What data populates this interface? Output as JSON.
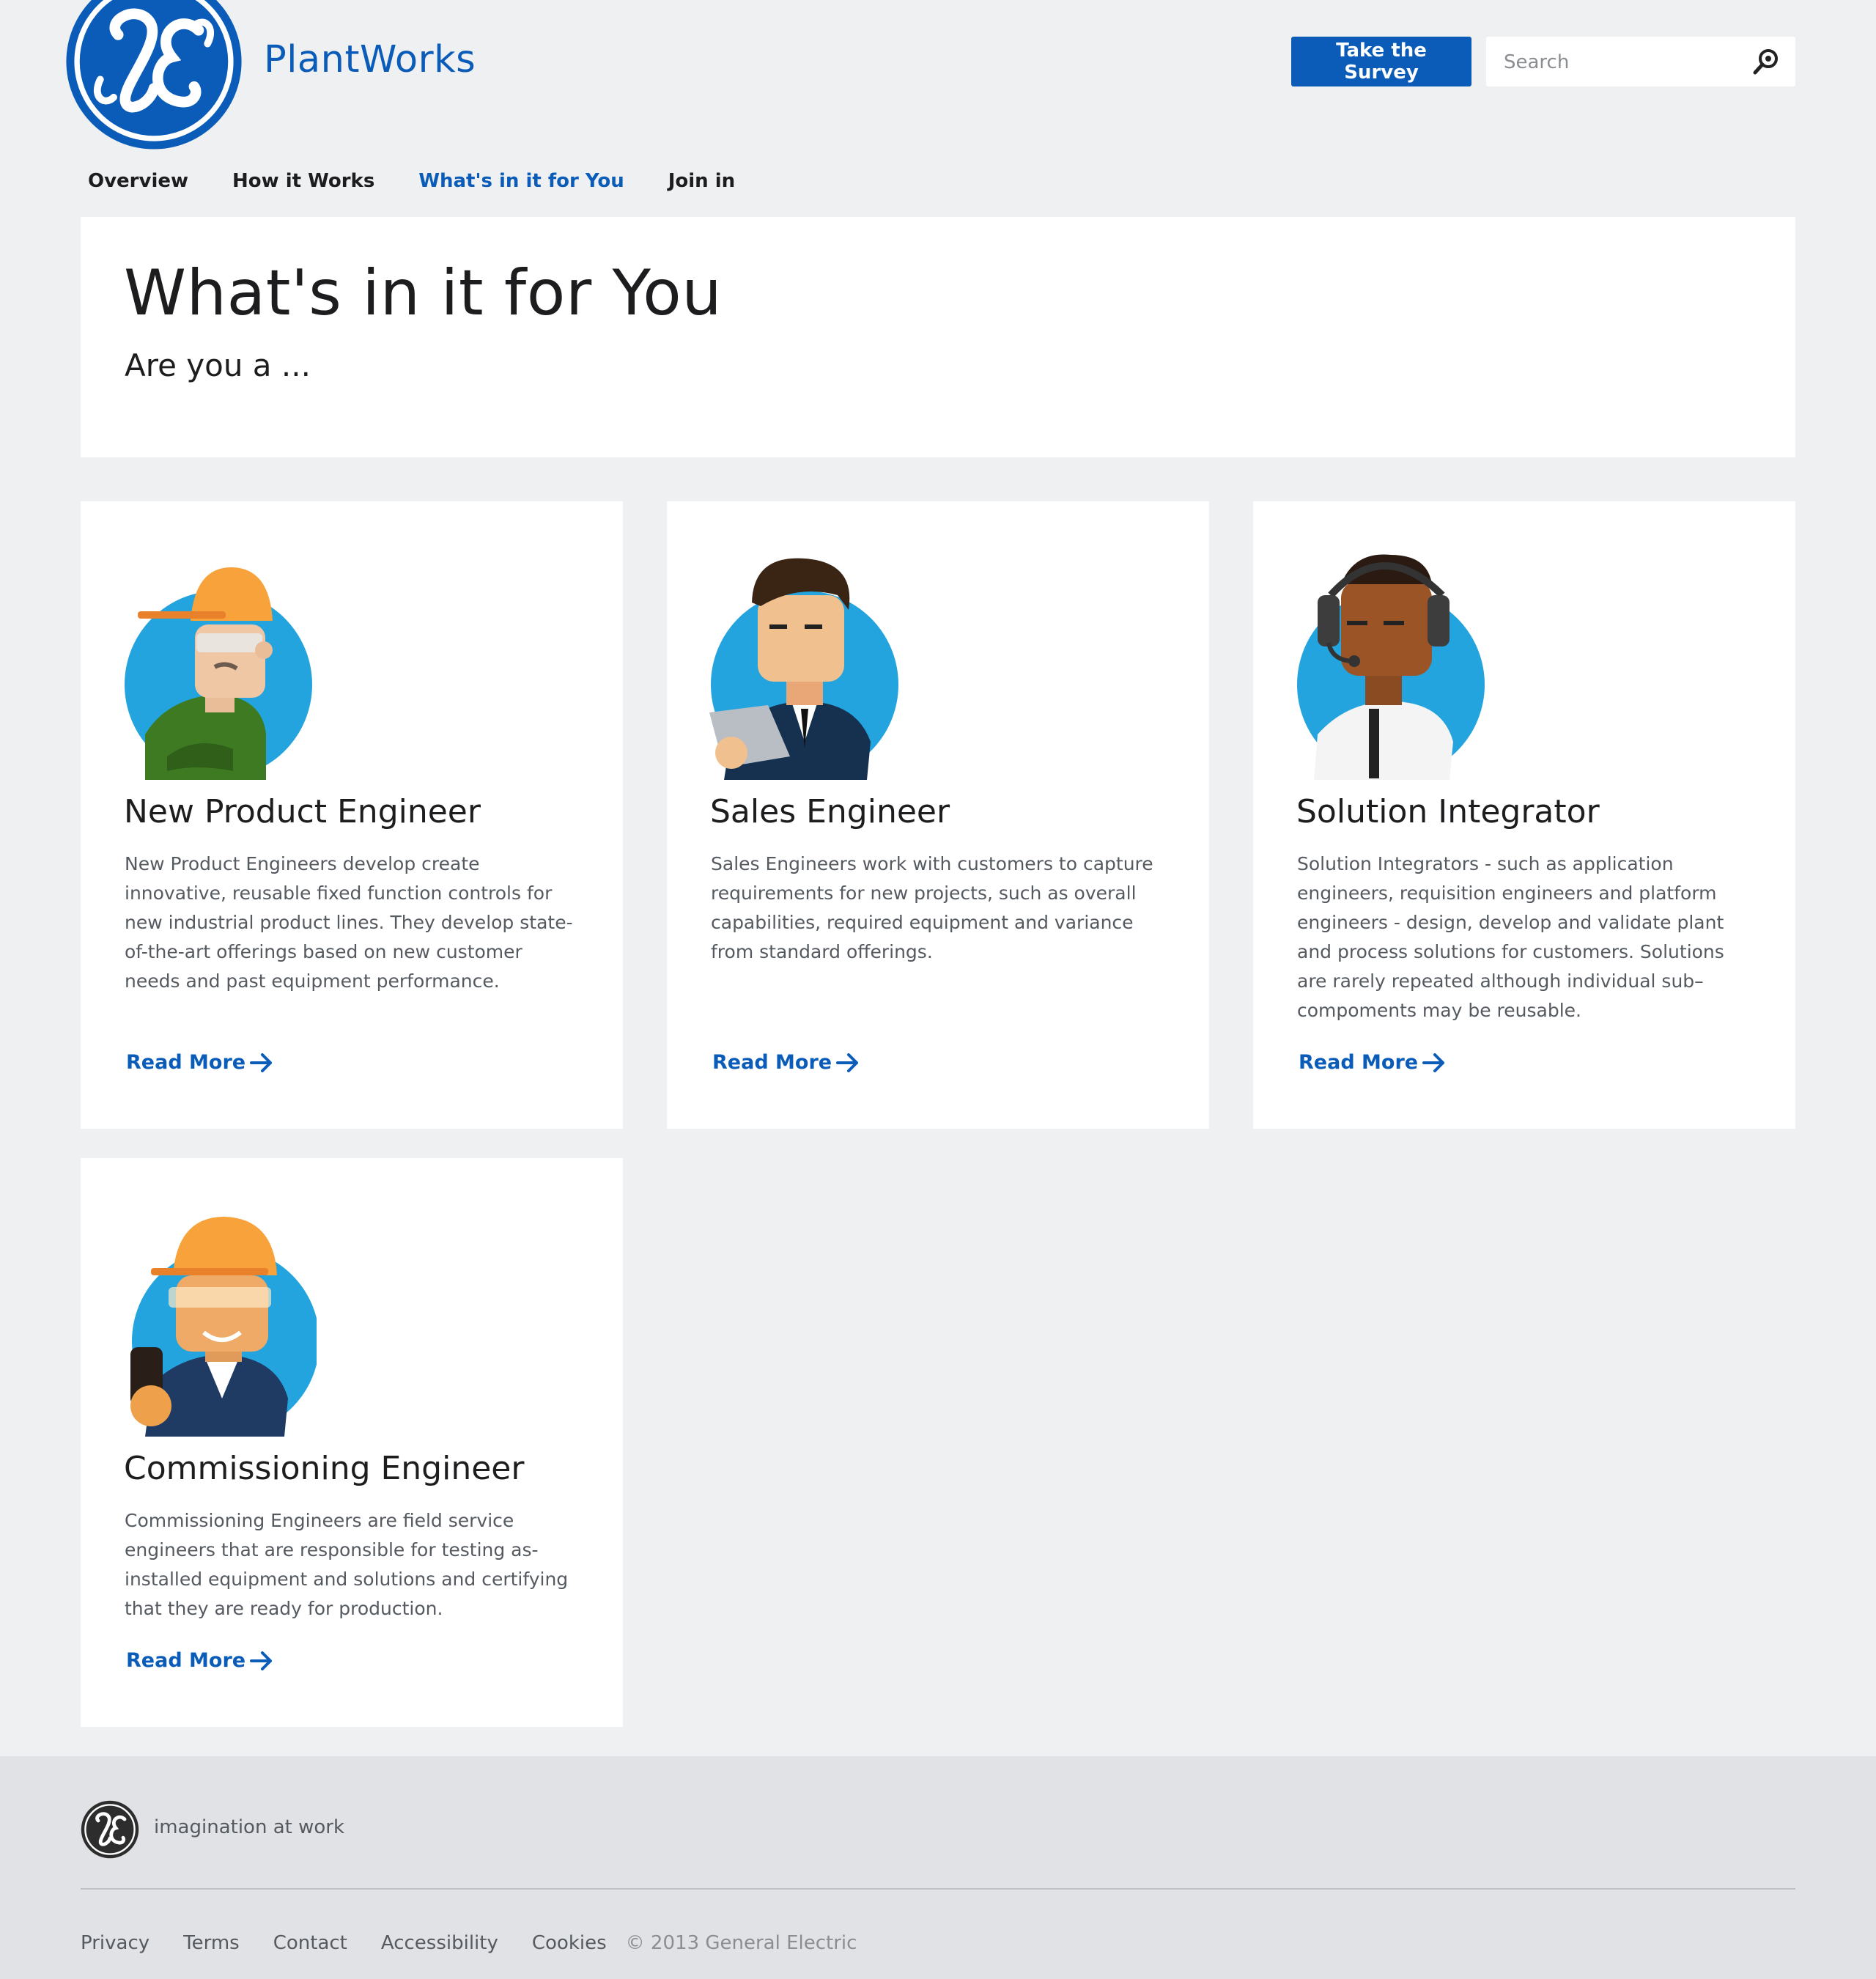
{
  "header": {
    "brand": "PlantWorks",
    "survey_label": "Take the Survey",
    "search_placeholder": "Search"
  },
  "nav": {
    "items": [
      {
        "label": "Overview"
      },
      {
        "label": "How it Works"
      },
      {
        "label": "What's in it for You",
        "active": true
      },
      {
        "label": "Join in"
      }
    ]
  },
  "hero": {
    "title": "What's in it for You",
    "subtitle": "Are you a ..."
  },
  "cards": [
    {
      "title": "New Product Engineer",
      "description": "New Product Engineers develop create innovative, reusable fixed function controls for new industrial product lines. They develop state-of-the-art offerings based on new customer needs and past equipment performance.",
      "link": "Read More"
    },
    {
      "title": "Sales Engineer",
      "description": "Sales Engineers work with customers to capture requirements for new projects, such as overall capabilities, required equipment and variance from standard offerings.",
      "link": "Read More"
    },
    {
      "title": "Solution Integrator",
      "description": "Solution Integrators - such as application engineers, requisition engineers and platform engineers - design, develop and validate plant and process solutions for customers. Solutions are rarely repeated although individual sub–compoments may be reusable.",
      "link": "Read More"
    },
    {
      "title": "Commissioning Engineer",
      "description": "Commissioning Engineers are field service engineers that are responsible for testing as-installed equipment and solutions and certifying that they are ready for production.",
      "link": "Read More"
    }
  ],
  "footer": {
    "tagline": "imagination at work",
    "links": [
      "Privacy",
      "Terms",
      "Contact",
      "Accessibility",
      "Cookies"
    ],
    "copyright": "© 2013 General Electric"
  },
  "colors": {
    "brand_blue": "#0a5cb8",
    "page_bg": "#eff0f2",
    "footer_bg": "#e1e2e5",
    "avatar_circle": "#24a4de"
  },
  "icons": [
    "ge-logo-icon",
    "search-icon",
    "arrow-right-icon"
  ]
}
